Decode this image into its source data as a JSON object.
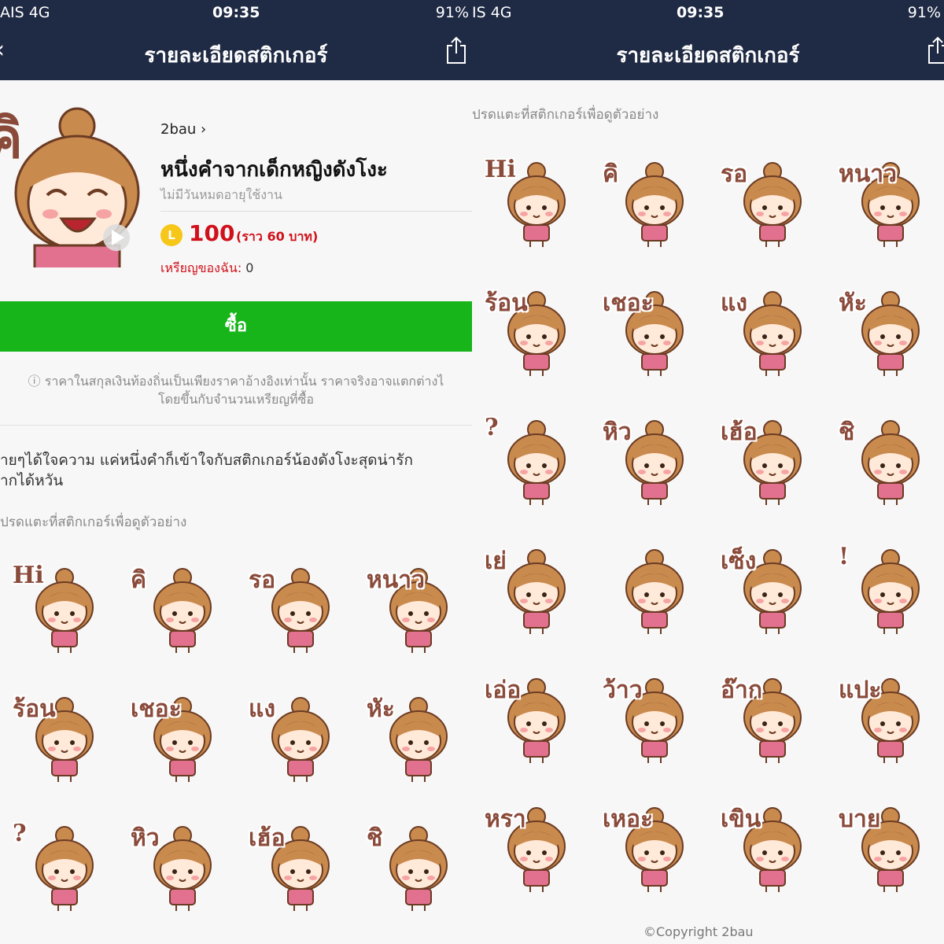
{
  "left": {
    "status": {
      "carrier": "AIS  4G",
      "time": "09:35",
      "battery": "91%"
    },
    "nav": {
      "back": "‹",
      "title": "รายละเอียดสติกเกอร์"
    },
    "header": {
      "author": "2bau  ›",
      "title": "หนึ่งคำจากเด็กหญิงดังโงะ",
      "validity": "ไม่มีวันหมดอายุใช้งาน",
      "coin_symbol": "L",
      "price": "100",
      "price_approx": "(ราว  60 บาท)",
      "my_coins_label": "เหรียญของฉัน:",
      "my_coins_value": "0",
      "hero_word": "คิ"
    },
    "buy_label": "ซื้อ",
    "note_line1": "ⓘ ราคาในสกุลเงินท้องถิ่นเป็นเพียงราคาอ้างอิงเท่านั้น ราคาจริงอาจแตกต่างไ",
    "note_line2": "โดยขึ้นกับจำนวนเหรียญที่ซื้อ",
    "desc_line1": "ายๆได้ใจความ แค่หนึ่งคำก็เข้าใจกับสติกเกอร์น้องดังโงะสุดน่ารัก",
    "desc_line2": "ากได้หวัน",
    "hint": "ปรดแตะที่สติกเกอร์เพื่อดูตัวอย่าง",
    "stickers": [
      "Hi",
      "คิ",
      "รอ",
      "หนาว",
      "ร้อน",
      "เชอะ",
      "แง",
      "หัะ",
      "?",
      "หิว",
      "เฮ้อ",
      "ชิ"
    ]
  },
  "right": {
    "status": {
      "carrier": "IS  4G",
      "time": "09:35",
      "battery": "91%"
    },
    "nav": {
      "title": "รายละเอียดสติกเกอร์"
    },
    "hint": "ปรดแตะที่สติกเกอร์เพื่อดูตัวอย่าง",
    "stickers": [
      "Hi",
      "คิ",
      "รอ",
      "หนาว",
      "ร้อน",
      "เชอะ",
      "แง",
      "หัะ",
      "?",
      "หิว",
      "เฮ้อ",
      "ชิ",
      "เย่",
      "",
      "เซ็ง",
      "!",
      "เอ่อ",
      "ว้าว",
      "อ๊าก",
      "แปะ",
      "หรา",
      "เหอะ",
      "เขิน",
      "บาย"
    ],
    "copyright": "©Copyright 2bau"
  },
  "colors": {
    "navbar": "#1f2a44",
    "buy": "#17b51a",
    "price": "#d0111b",
    "coin": "#f6c619",
    "hair": "#c98a4e",
    "shirt": "#e2708f"
  }
}
